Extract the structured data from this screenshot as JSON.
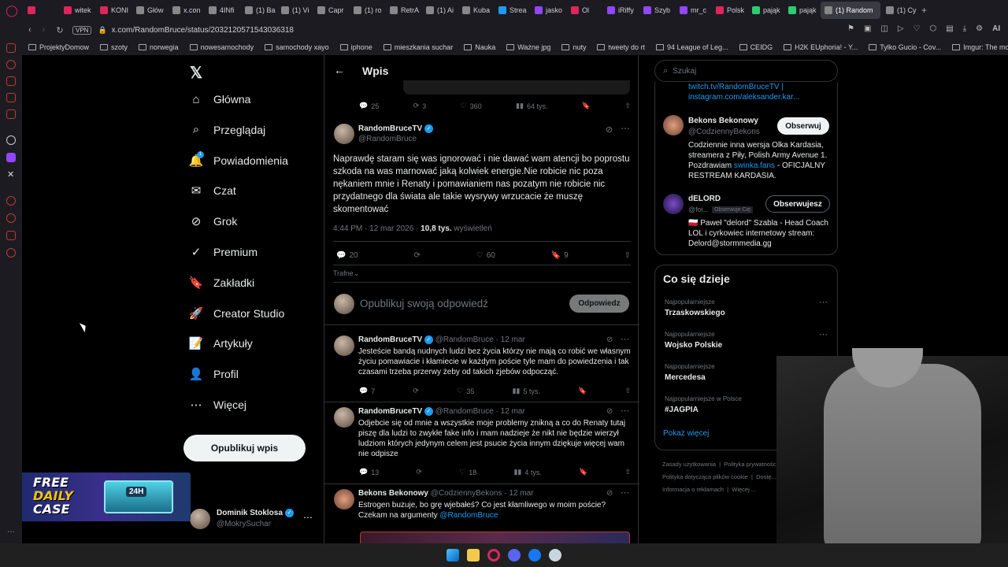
{
  "browser": {
    "tabs": [
      {
        "label": "",
        "color": "#e0245e"
      },
      {
        "label": "witek",
        "color": "#e0245e"
      },
      {
        "label": "KONI",
        "color": "#e0245e"
      },
      {
        "label": "Głów",
        "color": "#888"
      },
      {
        "label": "x.con",
        "color": "#888"
      },
      {
        "label": "4INfi",
        "color": "#888"
      },
      {
        "label": "(1) Ba",
        "color": "#888"
      },
      {
        "label": "(1) Vi",
        "color": "#888"
      },
      {
        "label": "Capr",
        "color": "#888"
      },
      {
        "label": "(1) ro",
        "color": "#888"
      },
      {
        "label": "RetrA",
        "color": "#888"
      },
      {
        "label": "(1) Ai",
        "color": "#888"
      },
      {
        "label": "Kuba",
        "color": "#888"
      },
      {
        "label": "Strea",
        "color": "#1d9bf0"
      },
      {
        "label": "jasko",
        "color": "#9146ff"
      },
      {
        "label": "Ol",
        "color": "#e0245e"
      },
      {
        "label": "iRiffy",
        "color": "#9146ff"
      },
      {
        "label": "Szyb",
        "color": "#9146ff"
      },
      {
        "label": "mr_c",
        "color": "#9146ff"
      },
      {
        "label": "Polsk",
        "color": "#e0245e"
      },
      {
        "label": "pająk",
        "color": "#2ecc71"
      },
      {
        "label": "pająk",
        "color": "#2ecc71"
      },
      {
        "label": "(1) Random",
        "color": "#888",
        "active": true
      },
      {
        "label": "(1) Cy",
        "color": "#888"
      }
    ],
    "url": "x.com/RandomBruce/status/2032120571543036318",
    "vpn_label": "VPN",
    "ai_label": "AI",
    "bookmarks": [
      "ProjektyDomow",
      "szoty",
      "norwegia",
      "nowesamochody",
      "samochody xayo",
      "iphone",
      "mieszkania suchar",
      "Nauka",
      "Ważne jpg",
      "nuty",
      "tweety do rt",
      "94 League of Leg...",
      "CEIDG",
      "H2K EUphoria! - Y...",
      "Tylko Gucio - Cov...",
      "Imgur: The most a..."
    ]
  },
  "nav": {
    "items": [
      {
        "label": "Główna",
        "icon": "home-icon",
        "glyph": "⌂"
      },
      {
        "label": "Przeglądaj",
        "icon": "search-icon",
        "glyph": "⌕"
      },
      {
        "label": "Powiadomienia",
        "icon": "bell-icon",
        "glyph": "🔔"
      },
      {
        "label": "Czat",
        "icon": "mail-icon",
        "glyph": "✉"
      },
      {
        "label": "Grok",
        "icon": "grok-icon",
        "glyph": "⊘"
      },
      {
        "label": "Premium",
        "icon": "premium-icon",
        "glyph": "✓"
      },
      {
        "label": "Zakładki",
        "icon": "bookmark-icon",
        "glyph": "🔖"
      },
      {
        "label": "Creator Studio",
        "icon": "rocket-icon",
        "glyph": "🚀"
      },
      {
        "label": "Artykuły",
        "icon": "article-icon",
        "glyph": "📝"
      },
      {
        "label": "Profil",
        "icon": "profile-icon",
        "glyph": "👤"
      },
      {
        "label": "Więcej",
        "icon": "more-icon",
        "glyph": "⋯"
      }
    ],
    "notif_badge": "1",
    "post_button": "Opublikuj wpis",
    "account": {
      "name": "Dominik Stoklosa",
      "handle": "@MokrySuchar"
    }
  },
  "header": {
    "title": "Wpis"
  },
  "prev_actions": {
    "replies": "25",
    "reposts": "3",
    "likes": "360",
    "views": "64 tys."
  },
  "main_post": {
    "name": "RandomBruceTV",
    "handle": "@RandomBruce",
    "text": "Naprawdę staram się was ignorować i nie dawać wam atencji bo poprostu szkoda na was marnować jaką kolwiek energie.Nie robicie nic poza nękaniem mnie i Renaty i pomawianiem nas pozatym nie robicie nic przydatnego dla świata ale takie wysrywy wrzucacie że muszę skomentować",
    "time": "4:44 PM · 12 mar 2026 · ",
    "views_count": "10,8 tys.",
    "views_label": " wyświetleń",
    "replies": "20",
    "likes": "60",
    "bookmarks": "9",
    "sort": "Trafne"
  },
  "compose": {
    "placeholder": "Opublikuj swoją odpowiedź",
    "button": "Odpowiedz"
  },
  "replies": [
    {
      "name": "RandomBruceTV",
      "handle": "@RandomBruce · 12 mar",
      "text": "Jesteście bandą nudnych ludzi bez życia którzy nie mają co robić we własnym życiu pomawiacie i kłamiecie w każdym poście tyle mam do powiedzenia i tak czasami trzeba przerwy żeby od takich zjebów odpocząć.",
      "replies": "7",
      "likes": "35",
      "views": "5 tys."
    },
    {
      "name": "RandomBruceTV",
      "handle": "@RandomBruce · 12 mar",
      "text": "Odjebcie się od mnie a wszystkie moje problemy znikną a co do Renaty tutaj piszę dla ludzi to zwykłe fake info i mam nadzieje że nikt nie będzie wierzył ludziom których jedynym celem jest psucie życia innym dziękuje więcej wam nie odpisze",
      "replies": "13",
      "likes": "18",
      "views": "4 tys."
    },
    {
      "name": "Bekons Bekonowy",
      "handle": "@CodziennyBekons · 12 mar",
      "text": "Estrogen buzuje, bo grę wjebałeś? Co jest kłamliwego w moim poście? Czekam na argumenty ",
      "mention": "@RandomBruce"
    }
  ],
  "right": {
    "search_placeholder": "Szukaj",
    "bio_lines": [
      "twitch.tv/RandomBruceTV |",
      "instagram.com/aleksander.kar..."
    ],
    "who": [
      {
        "name": "Bekons Bekonowy",
        "handle": "@CodziennyBekons",
        "button": "Obserwuj",
        "bio": "Codziennie inna wersja Olka Kardasia, streamera z Piły, Polish Army Avenue 1. Pozdrawiam ",
        "bio_link": "swinka.fans",
        "bio_end": " - OFICJALNY RESTREAM KARDASIA."
      },
      {
        "name": "dELORD",
        "handle": "@foi...",
        "follows_you": "Obserwuje Cię",
        "button": "Obserwujesz",
        "bio": "🇵🇱 Paweł \"delord\" Szabla - Head Coach LOL i cyrkowiec internetowy stream: Delord@stormmedia.gg"
      }
    ],
    "happening_title": "Co się dzieje",
    "trends": [
      {
        "meta": "Najpopularniejsze",
        "name": "Trzaskowskiego"
      },
      {
        "meta": "Najpopularniejsze",
        "name": "Wojsko Polskie"
      },
      {
        "meta": "Najpopularniejsze",
        "name": "Mercedesa"
      },
      {
        "meta": "Najpopularniejsze w Polsce",
        "name": "#JAGPIA"
      }
    ],
    "show_more": "Pokaż więcej",
    "footer": [
      "Zasady użytkowania",
      "Polityka prywatności",
      "Polityka dotycząca plików cookie",
      "Dostę...",
      "Informacja o reklamach",
      "Więcej ..."
    ]
  },
  "overlay": {
    "promo_line1": "FREE",
    "promo_line2": "DAILY",
    "promo_line3": "CASE",
    "promo_badge": "24H"
  }
}
